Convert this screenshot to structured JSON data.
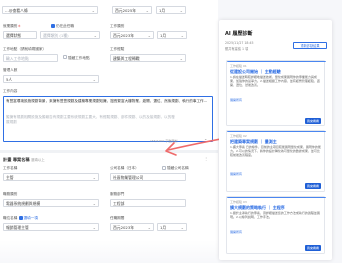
{
  "top": {
    "field1_value": "…@查看八條",
    "field2_value": "西元2025年",
    "field3_value": "1月"
  },
  "work": {
    "type_label": "就業類別",
    "type_required": "＊",
    "checkbox_current_label": "仍在此任職",
    "status_value": "選擇狀態",
    "category_label": "工作類別",
    "category_value": "選擇類別 (1種)",
    "period_label": "任職期間",
    "period_year": "西元2023年",
    "period_month": "1月",
    "location_label": "工作地點（請就填寫國家）",
    "location_placeholder": "輸入工作地點",
    "location_hide_label": "隱藏工作地點",
    "exp_label": "工作經驗",
    "exp_value": "建築與工程轉戰",
    "mgmt_label": "管理人數",
    "mgmt_value": "5人",
    "content_label": "工作內容",
    "content_text": "有豐富環境設施規劃背景，來擁有豐豐規劃及建築專業規劃知識，擅長繁富大樓物業，遞開、選位、然後規劃、執行的事工作…",
    "content_text_2": "擬擁有規劃相關設施及擬報告有規劃主要系統規劃主要大，有經驗規劃、部件規劃、以的及接規劃，以的發展規劃",
    "char_count": "155/1000 字數限制"
  },
  "section2": {
    "title": "計畫 專案名稱",
    "title_hint": "選填以上",
    "field_a_label": "工作名稱",
    "field_a_value": "主管",
    "field_b_label": "公司名稱（日本）",
    "field_b_value": "社區物業管理公司",
    "field_b_check": "隱藏公司名稱",
    "field_c_label": "職務類別",
    "field_c_value": "電器系統規劃與規模",
    "field_d_label": "服務部門",
    "field_d_value": "工程部",
    "field_e_label": "職位名稱",
    "field_e_check": "選填一項",
    "field_e_value": "報銷管理主管",
    "field_f_label": "任職期間",
    "field_f_year": "西元2023年",
    "field_f_month": "1月"
  },
  "panel": {
    "title": "AI 履歷診斷",
    "date": "2025/11/27 18:45",
    "summary": "體共有建議 1 項",
    "action_btn": "重新診斷結果",
    "cards": [
      {
        "tag": "工作經驗 01",
        "title": "從建設公司開始 ｜ 主動經驗",
        "body": "1.請在描述時較詳細地描述技術，量化成果展現你的專業能力與成果，加強你的競爭力。2.描述相關工作內容，並有經營管理經驗，遞開、選位、然後改善。",
        "more": "展開所有",
        "btn": "我來看看"
      },
      {
        "tag": "工作經驗 02",
        "title": "把建築專案規劃 ｜ 量測主",
        "body": "1.擴大專案 日的條件，目前的主項目較能展現量化成果，展現你的能力。2.可以的情況下，將你的設計轉化為可量化的數據成果，並可比較前後改善程度。",
        "more": "展開所有",
        "btn": "我來看看"
      },
      {
        "tag": "工作經驗 03",
        "title": "擴大規劃的策略執行 ｜ 主程序",
        "body": "1.關於主導執行的專案，須詳細描述您的工作方法或執行的過程並展現。2.以條列說明，工作手法。",
        "more": "展開所有",
        "btn": "我來看看"
      }
    ]
  }
}
